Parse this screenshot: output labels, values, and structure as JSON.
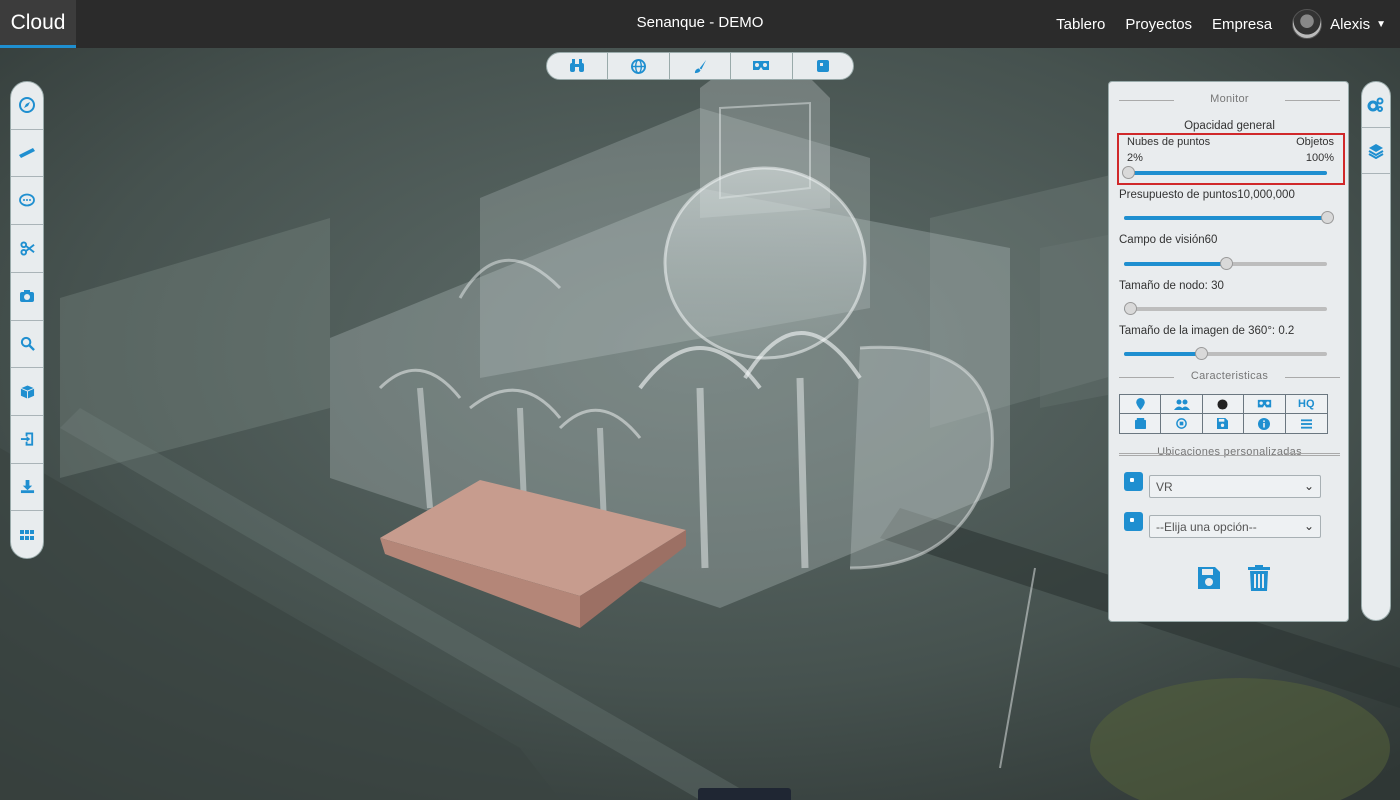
{
  "header": {
    "brand": "Cloud",
    "title": "Senanque - DEMO",
    "nav": [
      "Tablero",
      "Proyectos",
      "Empresa"
    ],
    "user": "Alexis"
  },
  "top_toolbar": [
    "binoculars-icon",
    "globe-icon",
    "brush-icon",
    "vr-headset-icon",
    "square-icon"
  ],
  "left_toolbar": [
    "compass-icon",
    "ruler-icon",
    "comment-icon",
    "scissors-icon",
    "camera-icon",
    "search-icon",
    "cube-icon",
    "import-icon",
    "download-icon",
    "grid-icon"
  ],
  "right_toolbar": [
    "cogs-icon",
    "layers-icon"
  ],
  "monitor": {
    "title": "Monitor",
    "opacity": {
      "label": "Opacidad general",
      "left_label": "Nubes de puntos",
      "right_label": "Objetos",
      "left_value": "2%",
      "right_value": "100%",
      "level": 0.02
    },
    "point_budget": {
      "label": "Presupuesto de puntos",
      "value": "10,000,000",
      "level": 1.0
    },
    "fov": {
      "label": "Campo de visión",
      "value": "60",
      "level": 0.5
    },
    "node_size": {
      "label": "Tamaño de nodo: 30",
      "level": 0.03
    },
    "image360": {
      "label": "Tamaño de la imagen de 360°: 0.2",
      "level": 0.38
    }
  },
  "features": {
    "title": "Caracteristicas",
    "items": [
      "marker-icon",
      "users-icon",
      "circle-icon",
      "vr-headset-icon",
      "HQ",
      "card-icon",
      "stop-icon",
      "save-icon",
      "info-icon",
      "list-icon"
    ]
  },
  "locations": {
    "title": "Ubicaciones personalizadas",
    "select1": "VR",
    "select2": "--Elija una opción--"
  },
  "colors": {
    "accent": "#1f8fd0",
    "topbar": "#2b2b2b",
    "panel": "#e9ecee",
    "highlight": "#d0282a",
    "box": "#c49a8c"
  }
}
